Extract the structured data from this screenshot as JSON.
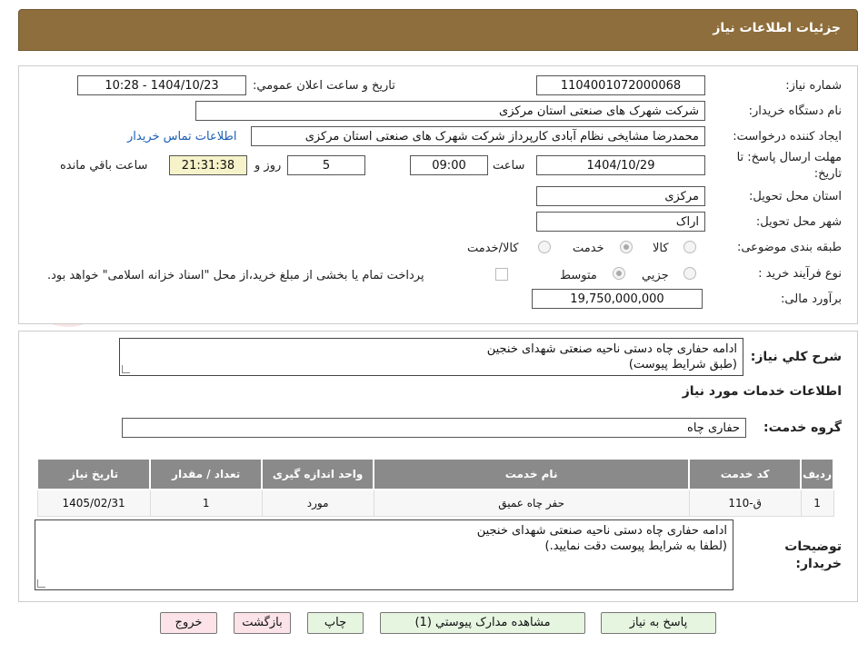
{
  "header": {
    "title": "جزئیات اطلاعات نیاز"
  },
  "form": {
    "need_number_label": "شماره نیاز:",
    "need_number": "1104001072000068",
    "announce_label": "تاریخ و ساعت اعلان عمومي:",
    "announce_value": "1404/10/23 - 10:28",
    "buyer_org_label": "نام دستگاه خريدار:",
    "buyer_org": "شرکت شهرک های صنعتی استان مرکزی",
    "requester_label": "ايجاد کننده درخواست:",
    "requester": "محمدرضا مشایخی نظام آبادی کارپرداز شرکت شهرک های صنعتی استان مرکزی",
    "contact_link": "اطلاعات تماس خريدار",
    "deadline_label_1": "مهلت ارسال پاسخ: تا",
    "deadline_label_2": "تاريخ:",
    "deadline_date": "1404/10/29",
    "time_label": "ساعت",
    "deadline_time": "09:00",
    "days_value": "5",
    "days_label": "روز و",
    "remaining_time": "21:31:38",
    "remaining_label": "ساعت باقي مانده",
    "province_label": "استان محل تحويل:",
    "province": "مرکزی",
    "city_label": "شهر محل تحويل:",
    "city": "اراک",
    "category_label": "طبقه بندی موضوعی:",
    "category_goods": "کالا",
    "category_service": "خدمت",
    "category_both": "کالا/خدمت",
    "process_label": "نوع فرآيند خريد :",
    "process_partial": "جزيي",
    "process_medium": "متوسط",
    "payment_note": "پرداخت تمام يا بخشی از مبلغ خريد،از محل \"اسناد خزانه اسلامی\" خواهد بود.",
    "budget_label": "برآورد مالی:",
    "budget": "19,750,000,000"
  },
  "description": {
    "label": "شرح کلي نياز:",
    "line1": "ادامه حفاری چاه دستی ناحیه صنعتی شهدای خنجین",
    "line2": "(طبق شرایط پیوست)"
  },
  "services": {
    "section_title": "اطلاعات خدمات مورد نياز",
    "group_label": "گروه خدمت:",
    "group_value": "حفاری چاه",
    "columns": [
      "رديف",
      "کد خدمت",
      "نام خدمت",
      "واحد اندازه گيری",
      "تعداد / مقدار",
      "تاريخ نياز"
    ],
    "rows": [
      [
        "1",
        "ق-110",
        "حفر چاه عمیق",
        "مورد",
        "1",
        "1405/02/31"
      ]
    ]
  },
  "buyer_notes": {
    "label_1": "توضيحات",
    "label_2": "خريدار:",
    "line1": "ادامه حفاری چاه دستی ناحیه صنعتی شهدای خنجین",
    "line2": "(لطفا به شرایط پیوست دقت نمایید.)"
  },
  "buttons": {
    "reply": "پاسخ به نياز",
    "attachments": "مشاهده مدارک پيوستي (1)",
    "print": "چاپ",
    "back": "بازگشت",
    "exit": "خروج"
  },
  "watermark": {
    "text": "AriaTender.net"
  }
}
